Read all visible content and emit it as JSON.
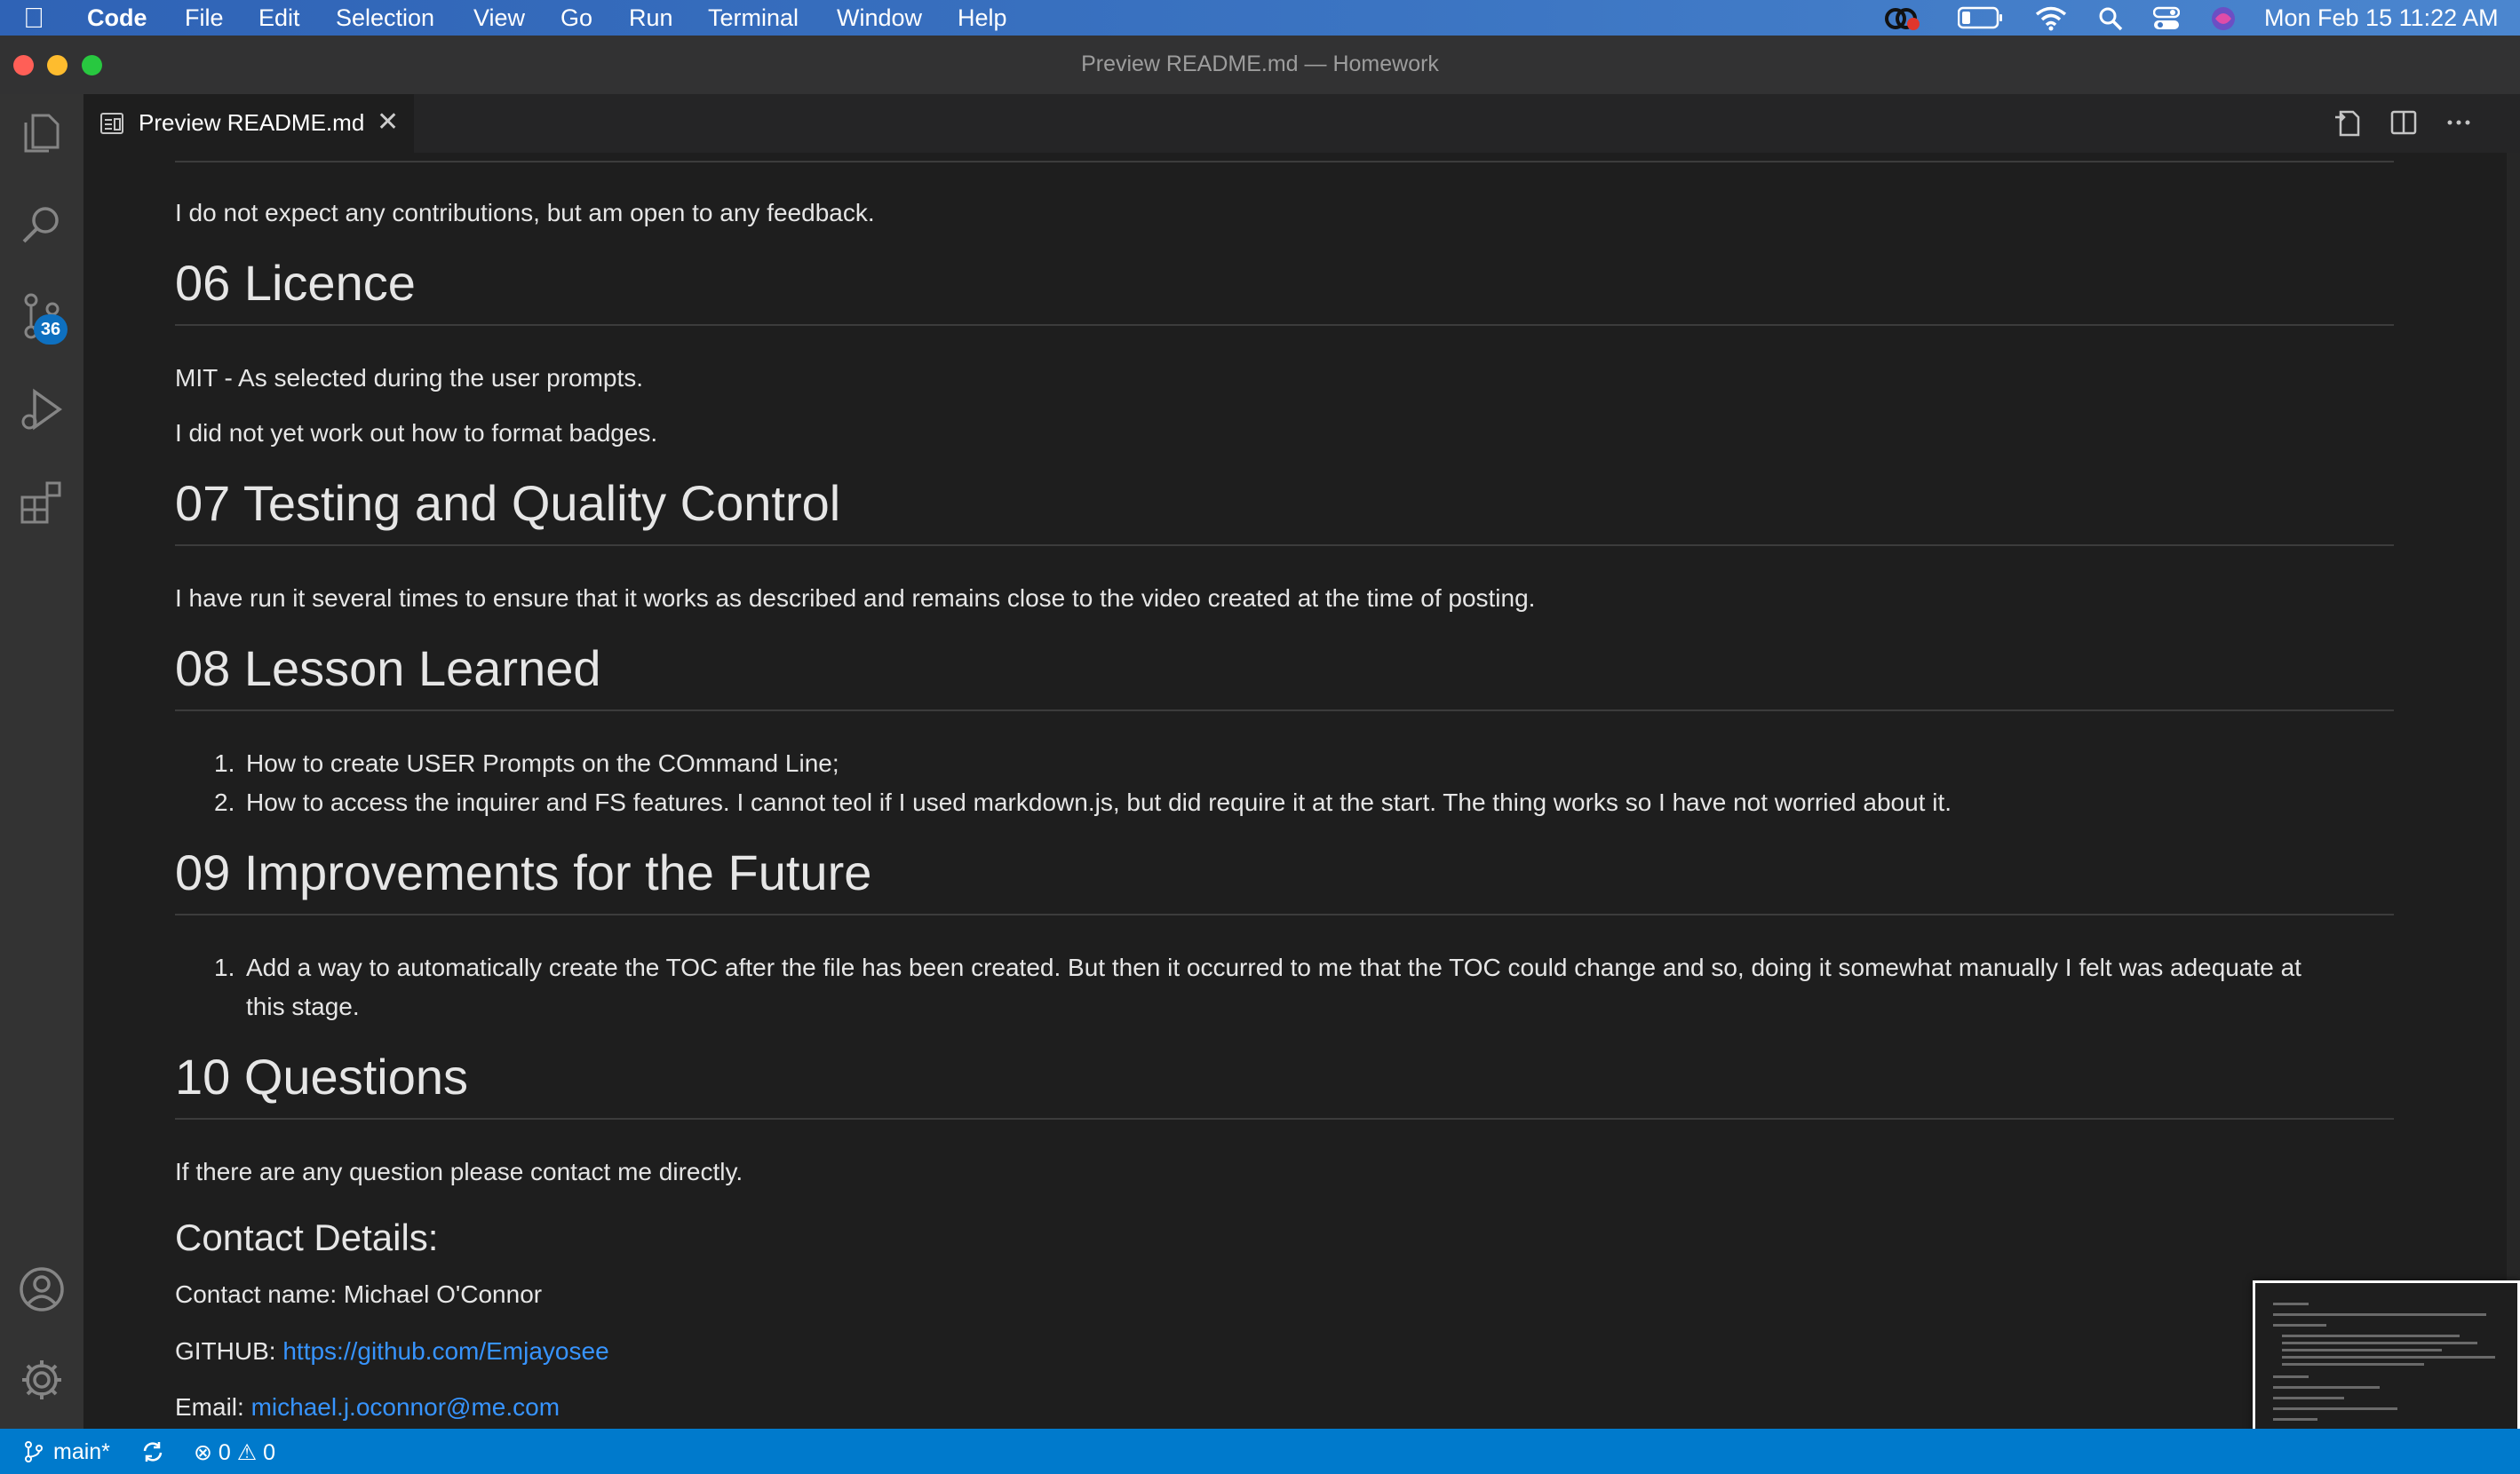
{
  "menubar": {
    "app_name": "Code",
    "menus": [
      "File",
      "Edit",
      "Selection",
      "View",
      "Go",
      "Run",
      "Terminal",
      "Window",
      "Help"
    ],
    "clock": "Mon Feb 15  11:22 AM"
  },
  "window": {
    "title": "Preview README.md — Homework"
  },
  "activity": {
    "scm_badge": "36"
  },
  "tab": {
    "label": "Preview README.md",
    "close": "✕"
  },
  "doc": {
    "p_contributions": "I do not expect any contributions, but am open to any feedback.",
    "h_licence": "06 Licence",
    "p_licence1": "MIT - As selected during the user prompts.",
    "p_licence2": "I did not yet work out how to format badges.",
    "h_testing": "07 Testing and Quality Control",
    "p_testing": "I have run it several times to ensure that it works as described and remains close to the video created at the time of posting.",
    "h_lessons": "08 Lesson Learned",
    "lessons": [
      "How to create USER Prompts on the COmmand Line;",
      "How to access the inquirer and FS features. I cannot teol if I used markdown.js, but did require it at the start. The thing works so I have not worried about it."
    ],
    "h_improvements": "09 Improvements for the Future",
    "improvements_line1": "Add a way to automatically create the TOC after the file has been created. But then it occurred to me that the TOC could change and so, doing it somewhat manually I felt was adequate at",
    "improvements_line2": "this stage.",
    "h_questions": "10 Questions",
    "p_questions": "If there are any question please contact me directly.",
    "h_contact": "Contact Details:",
    "contact_name": "Contact name: Michael O'Connor",
    "github_label": "GITHUB: ",
    "github_url": "https://github.com/Emjayosee",
    "email_label": "Email: ",
    "email": "michael.j.oconnor@me.com"
  },
  "statusbar": {
    "branch": "main*",
    "errors": "0",
    "warnings": "0"
  },
  "colors": {
    "accent": "#007acc",
    "link": "#3794ff",
    "badge": "#0e70c0",
    "traffic_red": "#ff5f57",
    "traffic_yellow": "#febc2e",
    "traffic_green": "#28c840"
  }
}
